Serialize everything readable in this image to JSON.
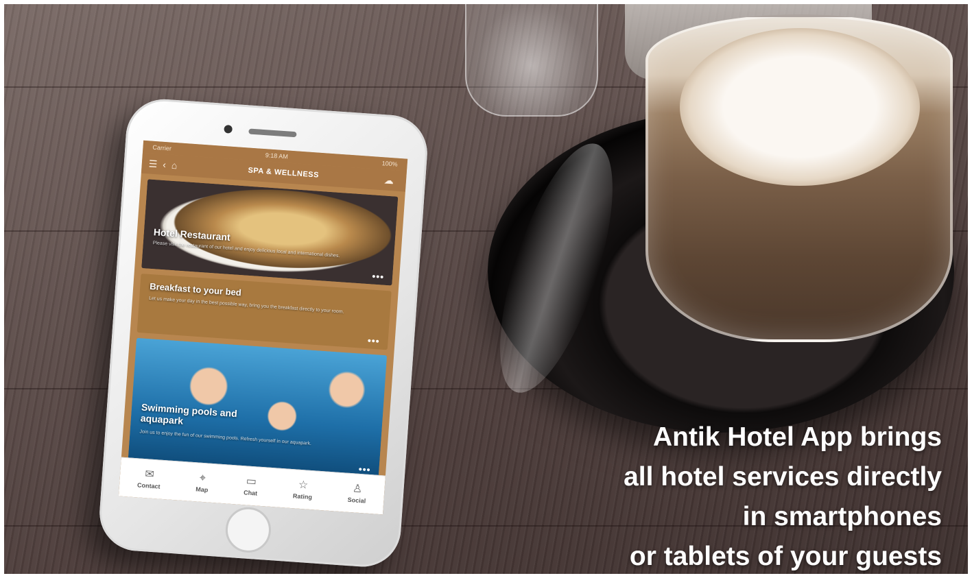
{
  "phone_app": {
    "status": {
      "carrier": "Carrier",
      "time": "9:18 AM",
      "battery": "100%"
    },
    "header": {
      "menu_icon": "hamburger-icon",
      "back_icon": "chevron-left-icon",
      "home_icon": "home-icon",
      "title": "SPA & WELLNESS",
      "weather_icon": "cloud-icon"
    },
    "cards": [
      {
        "title": "Hotel Restaurant",
        "description": "Please visit the restaurant of our hotel and enjoy delicious local and international dishes.",
        "more": "•••"
      },
      {
        "title": "Breakfast to your bed",
        "description": "Let us make your day in the best possible way, bring you the breakfast directly to your room.",
        "more": "•••"
      },
      {
        "title": "Swimming pools and aquapark",
        "description": "Join us to enjoy the fun of our swimming pools. Refresh yourself in our aquapark.",
        "more": "•••"
      }
    ],
    "tabs": [
      {
        "label": "Contact",
        "icon": "envelope-icon"
      },
      {
        "label": "Map",
        "icon": "map-pin-icon"
      },
      {
        "label": "Chat",
        "icon": "chat-bubble-icon"
      },
      {
        "label": "Rating",
        "icon": "star-icon"
      },
      {
        "label": "Social",
        "icon": "person-icon"
      }
    ]
  },
  "caption": {
    "line1": "Antik Hotel App brings",
    "line2": "all hotel services directly",
    "line3": "in smartphones",
    "line4": "or tablets of your guests"
  }
}
